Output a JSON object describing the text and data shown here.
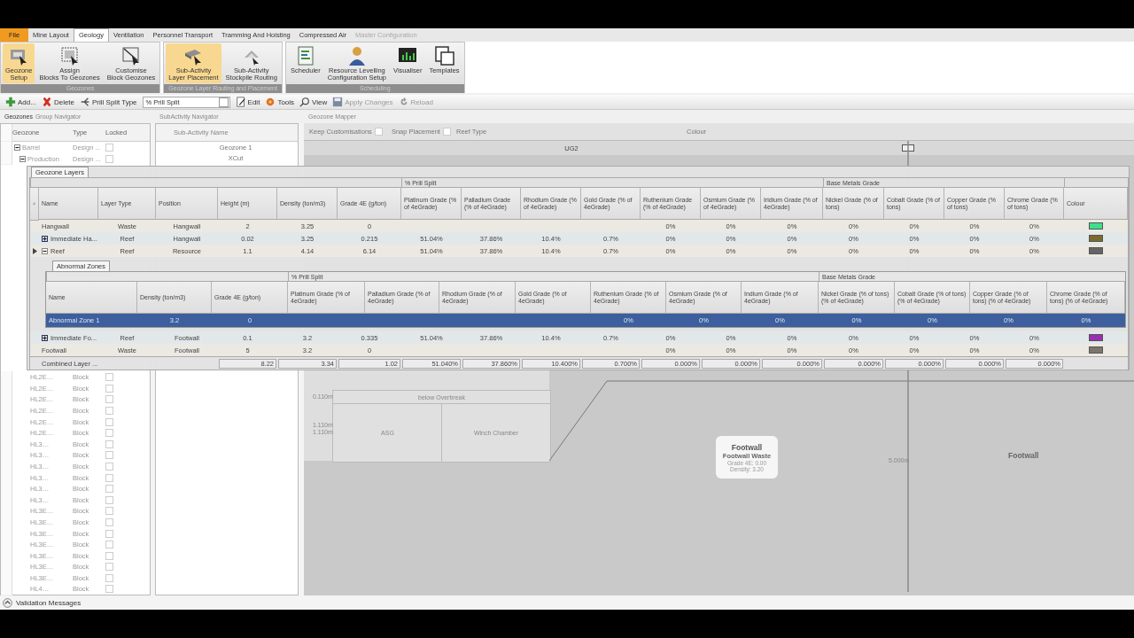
{
  "ribbon": {
    "tabs": [
      {
        "label": "File",
        "kind": "file",
        "selected": false,
        "disabled": false
      },
      {
        "label": "Mine Layout",
        "kind": "tab",
        "selected": false,
        "disabled": false
      },
      {
        "label": "Geology",
        "kind": "tab",
        "selected": true,
        "disabled": false
      },
      {
        "label": "Ventilation",
        "kind": "tab",
        "selected": false,
        "disabled": false
      },
      {
        "label": "Personnel Transport",
        "kind": "tab",
        "selected": false,
        "disabled": false
      },
      {
        "label": "Tramming And Hoisting",
        "kind": "tab",
        "selected": false,
        "disabled": false
      },
      {
        "label": "Compressed Air",
        "kind": "tab",
        "selected": false,
        "disabled": false
      },
      {
        "label": "Master Configuration",
        "kind": "tab",
        "selected": false,
        "disabled": true
      }
    ],
    "groups": [
      {
        "title": "Geozones",
        "buttons": [
          {
            "lines": [
              "Geozone",
              "Setup"
            ],
            "kind": "block-cursor",
            "selected": true
          },
          {
            "lines": [
              "Assign",
              "Blocks To Geozones"
            ],
            "kind": "frame-cursor",
            "selected": false
          },
          {
            "lines": [
              "Customise",
              "Block Geozones"
            ],
            "kind": "frame-slash",
            "selected": false
          }
        ]
      },
      {
        "title": "Geozone Layer Routing and Placement",
        "buttons": [
          {
            "lines": [
              "Sub-Activity",
              "Layer Placement"
            ],
            "kind": "slab-cursor",
            "selected": true
          },
          {
            "lines": [
              "Sub-Activity",
              "Stockpile Routing"
            ],
            "kind": "stack",
            "selected": false
          }
        ]
      },
      {
        "title": "Scheduling",
        "buttons": [
          {
            "lines": [
              "Scheduler"
            ],
            "kind": "document",
            "selected": false
          },
          {
            "lines": [
              "Resource Levelling",
              "Configuration Setup"
            ],
            "kind": "person",
            "selected": false
          },
          {
            "lines": [
              "Visualiser"
            ],
            "kind": "monitor",
            "selected": false
          },
          {
            "lines": [
              "Templates"
            ],
            "kind": "windows",
            "selected": false
          }
        ]
      }
    ]
  },
  "toolbar": [
    {
      "kind": "add",
      "label": "Add...",
      "disabled": false
    },
    {
      "kind": "delete",
      "label": "Delete",
      "disabled": false
    },
    {
      "kind": "prill",
      "label": "Prill Split Type",
      "disabled": false
    },
    {
      "kind": "select",
      "value": "% Prill Split"
    },
    {
      "kind": "edit",
      "label": "Edit",
      "disabled": false
    },
    {
      "kind": "tools",
      "label": "Tools",
      "disabled": false
    },
    {
      "kind": "view",
      "label": "View",
      "disabled": false
    },
    {
      "kind": "apply",
      "label": "Apply Changes",
      "disabled": true
    },
    {
      "kind": "reload",
      "label": "Reload",
      "disabled": true
    }
  ],
  "panels": {
    "group_navigator": {
      "title": "Geozones",
      "subtitle": "Group Navigator"
    },
    "subactivity_navigator": {
      "title": "SubActivity Navigator"
    },
    "geozone_mapper": {
      "title": "Geozone Mapper"
    }
  },
  "geozone_tree": {
    "columns": [
      "Geozone",
      "Type",
      "Locked"
    ],
    "rows": [
      {
        "name": "Barrel",
        "type": "Design ...",
        "locked": false,
        "expanded": true,
        "children": [
          {
            "name": "Production",
            "type": "Design ...",
            "locked": false,
            "expanded": true,
            "children": [
              {
                "name": "HL2E…",
                "type": "Block",
                "locked": false
              },
              {
                "name": "HL2E…",
                "type": "Block",
                "locked": false
              },
              {
                "name": "HL2E…",
                "type": "Block",
                "locked": false
              },
              {
                "name": "HL2E…",
                "type": "Block",
                "locked": false
              },
              {
                "name": "HL2E…",
                "type": "Block",
                "locked": false
              },
              {
                "name": "HL2E…",
                "type": "Block",
                "locked": false
              },
              {
                "name": "HL3…",
                "type": "Block",
                "locked": false
              },
              {
                "name": "HL3…",
                "type": "Block",
                "locked": false
              },
              {
                "name": "HL3…",
                "type": "Block",
                "locked": false
              },
              {
                "name": "HL3…",
                "type": "Block",
                "locked": false
              },
              {
                "name": "HL3…",
                "type": "Block",
                "locked": false
              },
              {
                "name": "HL3…",
                "type": "Block",
                "locked": false
              },
              {
                "name": "HL3E…",
                "type": "Block",
                "locked": false
              },
              {
                "name": "HL3E…",
                "type": "Block",
                "locked": false
              },
              {
                "name": "HL3E…",
                "type": "Block",
                "locked": false
              },
              {
                "name": "HL3E…",
                "type": "Block",
                "locked": false
              },
              {
                "name": "HL3E…",
                "type": "Block",
                "locked": false
              },
              {
                "name": "HL3E…",
                "type": "Block",
                "locked": false
              },
              {
                "name": "HL3E…",
                "type": "Block",
                "locked": false
              },
              {
                "name": "HL4…",
                "type": "Block",
                "locked": false
              }
            ]
          }
        ]
      }
    ]
  },
  "subactivities": {
    "column": "Sub-Activity Name",
    "rows": [
      "Geozone 1",
      "XCut"
    ]
  },
  "geozone_mapper": {
    "options": [
      {
        "label": "Keep Customisations",
        "checked": false
      },
      {
        "label": "Snap Placement",
        "checked": false
      }
    ],
    "columns": [
      "Reef Type",
      "Colour"
    ],
    "rows": [
      {
        "reef_type": "UG2"
      }
    ],
    "scale_labels": [
      "0.110m",
      "1.110m",
      "1.110m",
      "5.000m"
    ],
    "blocks": [
      "below Overbreak",
      "ASG",
      "Winch Chamber"
    ],
    "callout": {
      "title": "Footwall",
      "subtitle": "Footwall Waste",
      "lines": [
        "Grade 4E: 0.00",
        "Density: 3.20"
      ]
    },
    "side_label": "Footwall"
  },
  "geozone_layers": {
    "title": "Geozone Layers",
    "columns": [
      {
        "label": "Name",
        "kind": "text"
      },
      {
        "label": "Layer Type",
        "kind": "text"
      },
      {
        "label": "Position",
        "kind": "text"
      },
      {
        "label": "Height (m)",
        "kind": "text"
      },
      {
        "label": "Density (ton/m3)",
        "kind": "text"
      },
      {
        "label": "Grade 4E (g/ton)",
        "kind": "text"
      },
      {
        "label": "Platinum Grade (% of 4eGrade)",
        "kind": "text",
        "group": "% Prill Split"
      },
      {
        "label": "Palladium Grade (% of 4eGrade)",
        "kind": "text"
      },
      {
        "label": "Rhodium Grade (% of 4eGrade)",
        "kind": "text"
      },
      {
        "label": "Gold Grade (% of 4eGrade)",
        "kind": "text"
      },
      {
        "label": "Ruthenium Grade (% of 4eGrade)",
        "kind": "text"
      },
      {
        "label": "Osmium Grade (% of 4eGrade)",
        "kind": "text"
      },
      {
        "label": "Iridium Grade (% of 4eGrade)",
        "kind": "text"
      },
      {
        "label": "Nickel Grade (% of tons)",
        "kind": "text",
        "group": "Base Metals Grade"
      },
      {
        "label": "Cobalt Grade (% of tons)",
        "kind": "text"
      },
      {
        "label": "Copper Grade (% of tons)",
        "kind": "text"
      },
      {
        "label": "Chrome Grade (% of tons)",
        "kind": "text"
      },
      {
        "label": "Colour",
        "kind": "swatch"
      }
    ],
    "rows": [
      {
        "cells": [
          "Hangwall",
          "Waste",
          "Hangwall",
          "2",
          "3.25",
          "0",
          null,
          null,
          null,
          null,
          "0%",
          "0%",
          "0%",
          "0%",
          "0%",
          "0%",
          "0%"
        ],
        "color": "#3ee08c",
        "selected": false
      },
      {
        "cells": [
          "Immediate Ha...",
          "Reef",
          "Hangwall",
          "0.02",
          "3.25",
          "0.215",
          "51.04%",
          "37.86%",
          "10.4%",
          "0.7%",
          "0%",
          "0%",
          "0%",
          "0%",
          "0%",
          "0%",
          "0%"
        ],
        "color": "#7a6a2c",
        "selected": false,
        "expanded": false
      },
      {
        "cells": [
          "Reef",
          "Reef",
          "Resource",
          "1.1",
          "4.14",
          "6.14",
          "51.04%",
          "37.86%",
          "10.4%",
          "0.7%",
          "0%",
          "0%",
          "0%",
          "0%",
          "0%",
          "0%",
          "0%"
        ],
        "color": "#666666",
        "selected": true,
        "expanded": true,
        "children": {
          "title": "Abnormal Zones",
          "columns": [
            {
              "label": "Name"
            },
            {
              "label": "Density (ton/m3)"
            },
            {
              "label": "Grade 4E (g/ton)"
            },
            {
              "label": "Platinum Grade (% of 4eGrade)",
              "group": "% Prill Split"
            },
            {
              "label": "Palladium Grade (% of 4eGrade)"
            },
            {
              "label": "Rhodium Grade (% of 4eGrade)"
            },
            {
              "label": "Gold Grade (% of 4eGrade)"
            },
            {
              "label": "Ruthenium Grade (% of 4eGrade)"
            },
            {
              "label": "Osmium Grade (% of 4eGrade)"
            },
            {
              "label": "Indium Grade (% of 4eGrade)"
            },
            {
              "label": "Nickel Grade (% of tons) (% of 4eGrade)",
              "group": "Base Metals Grade"
            },
            {
              "label": "Cobalt Grade (% of tons) (% of 4eGrade)"
            },
            {
              "label": "Copper Grade (% of tons) (% of 4eGrade)"
            },
            {
              "label": "Chrome Grade (% of tons) (% of 4eGrade)"
            }
          ],
          "rows": [
            {
              "cells": [
                "Abnormal Zone 1",
                "3.2",
                "0",
                null,
                null,
                null,
                null,
                "0%",
                "0%",
                "0%",
                "0%",
                "0%",
                "0%",
                "0%"
              ],
              "selected": true
            }
          ]
        }
      },
      {
        "cells": [
          "Immediate Fo...",
          "Reef",
          "Footwall",
          "0.1",
          "3.2",
          "0.335",
          "51.04%",
          "37.86%",
          "10.4%",
          "0.7%",
          "0%",
          "0%",
          "0%",
          "0%",
          "0%",
          "0%",
          "0%"
        ],
        "color": "#9a2fb4",
        "selected": false,
        "expanded": false
      },
      {
        "cells": [
          "Footwall",
          "Waste",
          "Footwall",
          "5",
          "3.2",
          "0",
          null,
          null,
          null,
          null,
          "0%",
          "0%",
          "0%",
          "0%",
          "0%",
          "0%",
          "0%"
        ],
        "color": "#7c766a",
        "selected": false
      }
    ],
    "totals": {
      "label": "Combined Layer ...",
      "cells": [
        null,
        null,
        "8.22",
        "3.34",
        "1.02",
        "51.040%",
        "37.860%",
        "10.400%",
        "0.700%",
        "0.000%",
        "0.000%",
        "0.000%",
        "0.000%",
        "0.000%",
        "0.000%",
        "0.000%"
      ]
    }
  },
  "status_bar": {
    "label": "Validation Messages"
  }
}
